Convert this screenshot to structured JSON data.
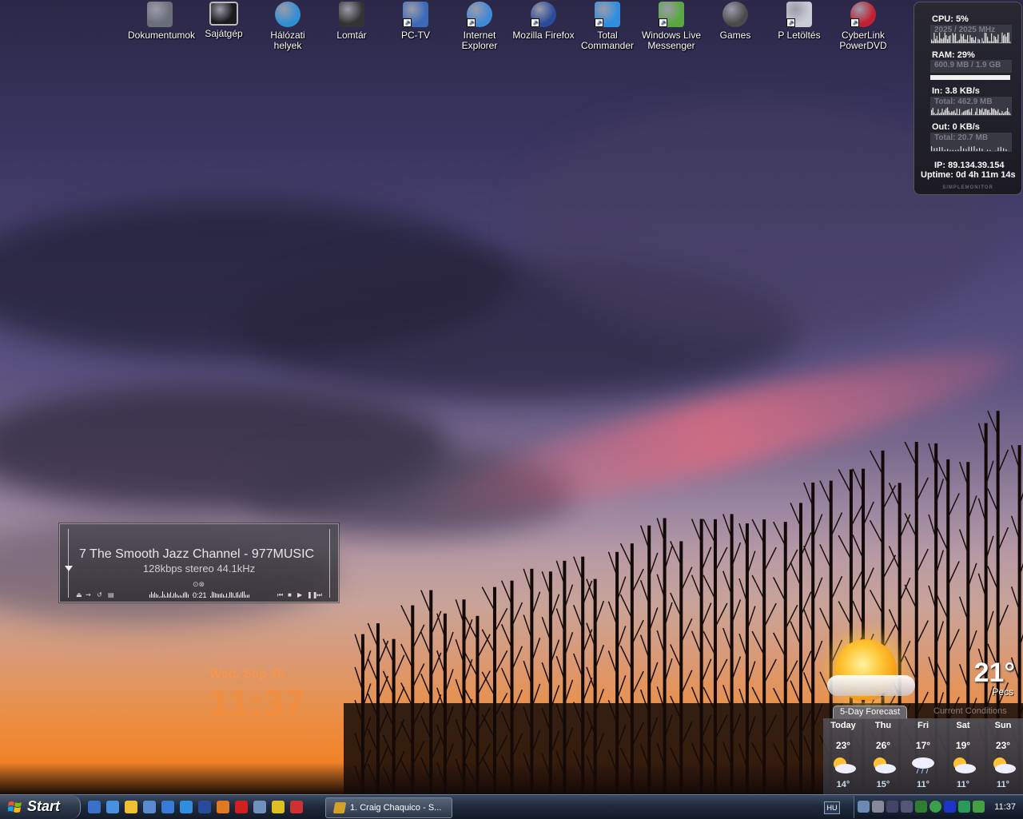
{
  "desktop_icons": [
    {
      "label": "Dokumentumok",
      "icon": "documents-folder-icon",
      "shortcut": false
    },
    {
      "label": "Sajátgép",
      "icon": "my-computer-icon",
      "shortcut": false
    },
    {
      "label": "Hálózati helyek",
      "icon": "network-places-icon",
      "shortcut": false
    },
    {
      "label": "Lomtár",
      "icon": "recycle-bin-icon",
      "shortcut": false
    },
    {
      "label": "PC-TV",
      "icon": "pc-tv-icon",
      "shortcut": true
    },
    {
      "label": "Internet Explorer",
      "icon": "internet-explorer-icon",
      "shortcut": true
    },
    {
      "label": "Mozilla Firefox",
      "icon": "firefox-icon",
      "shortcut": true
    },
    {
      "label": "Total Commander",
      "icon": "total-commander-icon",
      "shortcut": true
    },
    {
      "label": "Windows Live Messenger",
      "icon": "messenger-icon",
      "shortcut": true
    },
    {
      "label": "Games",
      "icon": "games-icon",
      "shortcut": false
    },
    {
      "label": "P Letöltés",
      "icon": "downloads-folder-icon",
      "shortcut": true
    },
    {
      "label": "CyberLink PowerDVD",
      "icon": "powerdvd-icon",
      "shortcut": true
    }
  ],
  "sysmon": {
    "cpu_label": "CPU: 5%",
    "cpu_sub": "2025 / 2025 MHz",
    "ram_label": "RAM: 29%",
    "ram_sub": "600.9 MB / 1.9 GB",
    "ram_fraction": 0.29,
    "in_label": "In: 3.8 KB/s",
    "in_sub": "Total: 462.9 MB",
    "out_label": "Out: 0 KB/s",
    "out_sub": "Total: 20.7 MB",
    "ip": "IP: 89.134.39.154",
    "uptime": "Uptime: 0d 4h 11m 14s",
    "brand": "SIMPLEMONITOR"
  },
  "player": {
    "title": "7 The Smooth Jazz Channel - 977MUSIC",
    "info": "128kbps stereo 44.1kHz",
    "time": "0:21"
  },
  "clock_widget": {
    "date": "Wed, Sep 30",
    "time": "11:37"
  },
  "weather": {
    "temp": "21°",
    "city": "Pecs",
    "tab_forecast": "5-Day Forecast",
    "tab_current": "Current Conditions",
    "days": [
      {
        "day": "Today",
        "hi": "23°",
        "lo": "14°",
        "icon": "partly-cloudy-icon"
      },
      {
        "day": "Thu",
        "hi": "26°",
        "lo": "15°",
        "icon": "partly-cloudy-icon"
      },
      {
        "day": "Fri",
        "hi": "17°",
        "lo": "11°",
        "icon": "rain-icon"
      },
      {
        "day": "Sat",
        "hi": "19°",
        "lo": "11°",
        "icon": "partly-cloudy-icon"
      },
      {
        "day": "Sun",
        "hi": "23°",
        "lo": "11°",
        "icon": "partly-cloudy-icon"
      }
    ]
  },
  "taskbar": {
    "start_label": "Start",
    "task_button": "1. Craig Chaquico - S...",
    "language": "HU",
    "clock": "11:37"
  }
}
